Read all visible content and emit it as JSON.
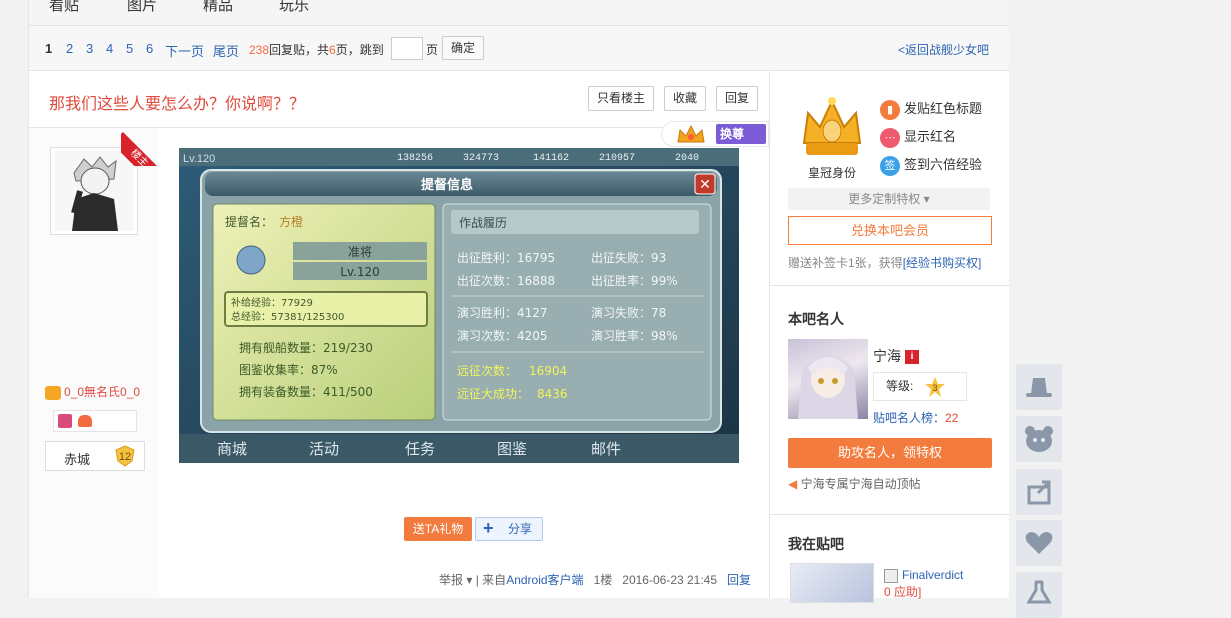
{
  "tabs": [
    "看贴",
    "图片",
    "精品",
    "玩乐"
  ],
  "pager": {
    "current": "1",
    "pages": [
      "2",
      "3",
      "4",
      "5",
      "6"
    ],
    "next": "下一页",
    "last": "尾页",
    "reply_count": "238",
    "reply_label": "回复贴，共",
    "page_count": "6",
    "page_label": "页，跳到",
    "page_unit": "页",
    "confirm": "确定",
    "back": "<返回战舰少女吧"
  },
  "thread": {
    "title": "那我们这些人要怎么办？你说啊？？",
    "only_op": "只看楼主",
    "favorite": "收藏",
    "reply": "回复"
  },
  "post": {
    "op_badge": "楼主",
    "username": "0_0無名氏0_0",
    "level_name": "赤城",
    "level_num": "12",
    "gift": "送TA礼物",
    "share": "分享",
    "report": "举报",
    "source_prefix": "| 来自",
    "source": "Android客户端",
    "floor": "1楼",
    "time": "2016-06-23 21:45",
    "reply": "回复",
    "exchange_badge": "换尊"
  },
  "game": {
    "top": [
      "Lv.120",
      "138256",
      "324773",
      "141162",
      "210957",
      "2040"
    ],
    "dialog_title": "提督信息",
    "name_label": "提督名：",
    "name": "方橙",
    "rank": "准将",
    "level": "Lv.120",
    "exp1": "补给经验：77929",
    "exp2": "总经验：57381/125300",
    "ships": "拥有舰船数量：219/230",
    "collect": "图鉴收集率：87%",
    "equips": "拥有装备数量：411/500",
    "record_title": "作战履历",
    "r1a": "出征胜利：16795",
    "r1b": "出征失败：93",
    "r2a": "出征次数：16888",
    "r2b": "出征胜率：99%",
    "r3a": "演习胜利：4127",
    "r3b": "演习失败：78",
    "r4a": "演习次数：4205",
    "r4b": "演习胜率：98%",
    "r5a": "远征次数：",
    "r5b": "16904",
    "r6a": "远征大成功：",
    "r6b": "8436",
    "menu": [
      "商城",
      "活动",
      "任务",
      "图鉴",
      "邮件"
    ]
  },
  "sidebar": {
    "crown_label": "皇冠身份",
    "privileges": [
      "发贴红色标题",
      "显示红名",
      "签到六倍经验"
    ],
    "privilege_icons": [
      "bookmark-icon",
      "chat-icon",
      "sign-icon"
    ],
    "privilege_sign_char": "签",
    "more": "更多定制特权",
    "exchange": "兑换本吧会员",
    "gift_text": "赠送补签卡1张，获得",
    "gift_link": "[经验书购买权]",
    "celeb_title": "本吧名人",
    "celeb_name": "宁海",
    "celeb_level_label": "等级:",
    "celeb_level": "3",
    "celeb_rank_label": "贴吧名人榜：",
    "celeb_rank": "22",
    "help_button": "助攻名人，领特权",
    "auto_top": "宁海专属宁海自动顶帖",
    "mybar_title": "我在贴吧",
    "mybar_name": "Finalverdict",
    "mybar_sub": "0 应助]"
  },
  "colors": {
    "accent": "#f47b3e",
    "link": "#2d64b3",
    "title_red": "#e04b3e",
    "crown_gold": "#f0a31c"
  }
}
